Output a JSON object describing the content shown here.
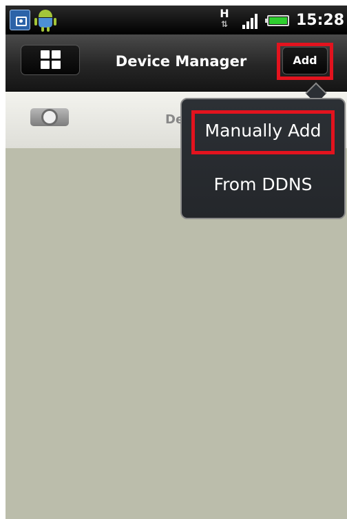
{
  "status_bar": {
    "time": "15:28",
    "network_type": "H",
    "network_arrows": "⇅",
    "icons": [
      "camera-notification-icon",
      "android-icon",
      "signal-icon",
      "battery-icon"
    ]
  },
  "header": {
    "title": "Device Manager",
    "add_label": "Add",
    "menu_icon": "grid-icon"
  },
  "toolbar": {
    "label_partial": "De",
    "icon": "camera-icon"
  },
  "popup_menu": {
    "items": [
      {
        "label": "Manually Add"
      },
      {
        "label": "From DDNS"
      }
    ]
  },
  "colors": {
    "highlight": "#e3131e",
    "content_bg": "#bbbdab",
    "battery": "#2fcf2f"
  }
}
